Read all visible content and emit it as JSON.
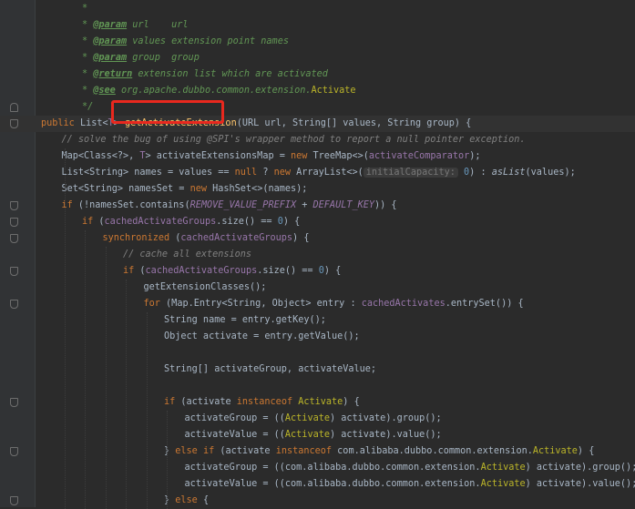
{
  "editor": {
    "language": "Java",
    "highlight": {
      "label": "getActivateExtension",
      "color": "#e8281e"
    },
    "lines": [
      {
        "indent": 4,
        "fold": "",
        "tokens": [
          {
            "t": "*",
            "c": "c-doc"
          }
        ]
      },
      {
        "indent": 4,
        "fold": "",
        "tokens": [
          {
            "t": "* ",
            "c": "c-doc"
          },
          {
            "t": "@param",
            "c": "c-tag"
          },
          {
            "t": " url    url",
            "c": "c-doc"
          }
        ]
      },
      {
        "indent": 4,
        "fold": "",
        "tokens": [
          {
            "t": "* ",
            "c": "c-doc"
          },
          {
            "t": "@param",
            "c": "c-tag"
          },
          {
            "t": " values extension point names",
            "c": "c-doc"
          }
        ]
      },
      {
        "indent": 4,
        "fold": "",
        "tokens": [
          {
            "t": "* ",
            "c": "c-doc"
          },
          {
            "t": "@param",
            "c": "c-tag"
          },
          {
            "t": " group  group",
            "c": "c-doc"
          }
        ]
      },
      {
        "indent": 4,
        "fold": "",
        "tokens": [
          {
            "t": "* ",
            "c": "c-doc"
          },
          {
            "t": "@return",
            "c": "c-tag"
          },
          {
            "t": " extension list which are activated",
            "c": "c-doc"
          }
        ]
      },
      {
        "indent": 4,
        "fold": "",
        "tokens": [
          {
            "t": "* ",
            "c": "c-doc"
          },
          {
            "t": "@see",
            "c": "c-tag"
          },
          {
            "t": " org.apache.dubbo.common.extension.",
            "c": "c-doc"
          },
          {
            "t": "Activate",
            "c": "c-ann"
          }
        ]
      },
      {
        "indent": 4,
        "fold": "close",
        "tokens": [
          {
            "t": "*/",
            "c": "c-doc"
          }
        ]
      },
      {
        "indent": 0,
        "fold": "open",
        "caret": true,
        "tokens": [
          {
            "t": "public ",
            "c": "c-kw"
          },
          {
            "t": "List<",
            "c": "c-type"
          },
          {
            "t": "T",
            "c": "c-fld"
          },
          {
            "t": "> ",
            "c": "c-type"
          },
          {
            "t": "getActivateExtension",
            "c": "c-fn"
          },
          {
            "t": "(URL url, String[] values, String group) {",
            "c": "c-type"
          }
        ]
      },
      {
        "indent": 2,
        "fold": "",
        "tokens": [
          {
            "t": "// solve the bug of using @SPI's wrapper method to report a null pointer exception.",
            "c": "c-cmt"
          }
        ]
      },
      {
        "indent": 2,
        "fold": "",
        "tokens": [
          {
            "t": "Map<Class<?>, ",
            "c": "c-type"
          },
          {
            "t": "T",
            "c": "c-fld"
          },
          {
            "t": "> activateExtensionsMap = ",
            "c": "c-type"
          },
          {
            "t": "new ",
            "c": "c-kw"
          },
          {
            "t": "TreeMap<>(",
            "c": "c-type"
          },
          {
            "t": "activateComparator",
            "c": "c-fld"
          },
          {
            "t": ");",
            "c": "c-type"
          }
        ]
      },
      {
        "indent": 2,
        "fold": "",
        "tokens": [
          {
            "t": "List<String> names = values == ",
            "c": "c-type"
          },
          {
            "t": "null",
            "c": "c-kw"
          },
          {
            "t": " ? ",
            "c": "c-type"
          },
          {
            "t": "new ",
            "c": "c-kw"
          },
          {
            "t": "ArrayList<>(",
            "c": "c-type"
          },
          {
            "t": "initialCapacity:",
            "c": "c-hint"
          },
          {
            "t": " ",
            "c": "c-type"
          },
          {
            "t": "0",
            "c": "c-num"
          },
          {
            "t": ") : ",
            "c": "c-type"
          },
          {
            "t": "asList",
            "c": "c-smeth"
          },
          {
            "t": "(values);",
            "c": "c-type"
          }
        ]
      },
      {
        "indent": 2,
        "fold": "",
        "tokens": [
          {
            "t": "Set<String> namesSet = ",
            "c": "c-type"
          },
          {
            "t": "new ",
            "c": "c-kw"
          },
          {
            "t": "HashSet<>(names);",
            "c": "c-type"
          }
        ]
      },
      {
        "indent": 2,
        "fold": "open",
        "tokens": [
          {
            "t": "if ",
            "c": "c-kw"
          },
          {
            "t": "(!namesSet.contains(",
            "c": "c-type"
          },
          {
            "t": "REMOVE_VALUE_PREFIX",
            "c": "c-sfld"
          },
          {
            "t": " + ",
            "c": "c-type"
          },
          {
            "t": "DEFAULT_KEY",
            "c": "c-sfld"
          },
          {
            "t": ")) {",
            "c": "c-type"
          }
        ]
      },
      {
        "indent": 4,
        "fold": "open",
        "tokens": [
          {
            "t": "if ",
            "c": "c-kw"
          },
          {
            "t": "(",
            "c": "c-type"
          },
          {
            "t": "cachedActivateGroups",
            "c": "c-fld"
          },
          {
            "t": ".size() == ",
            "c": "c-type"
          },
          {
            "t": "0",
            "c": "c-num"
          },
          {
            "t": ") {",
            "c": "c-type"
          }
        ]
      },
      {
        "indent": 6,
        "fold": "open",
        "tokens": [
          {
            "t": "synchronized ",
            "c": "c-kw"
          },
          {
            "t": "(",
            "c": "c-type"
          },
          {
            "t": "cachedActivateGroups",
            "c": "c-fld"
          },
          {
            "t": ") {",
            "c": "c-type"
          }
        ]
      },
      {
        "indent": 8,
        "fold": "",
        "tokens": [
          {
            "t": "// cache all extensions",
            "c": "c-cmt"
          }
        ]
      },
      {
        "indent": 8,
        "fold": "open",
        "tokens": [
          {
            "t": "if ",
            "c": "c-kw"
          },
          {
            "t": "(",
            "c": "c-type"
          },
          {
            "t": "cachedActivateGroups",
            "c": "c-fld"
          },
          {
            "t": ".size() == ",
            "c": "c-type"
          },
          {
            "t": "0",
            "c": "c-num"
          },
          {
            "t": ") {",
            "c": "c-type"
          }
        ]
      },
      {
        "indent": 10,
        "fold": "",
        "tokens": [
          {
            "t": "getExtensionClasses();",
            "c": "c-type"
          }
        ]
      },
      {
        "indent": 10,
        "fold": "open",
        "tokens": [
          {
            "t": "for ",
            "c": "c-kw"
          },
          {
            "t": "(Map.Entry<String, Object> entry : ",
            "c": "c-type"
          },
          {
            "t": "cachedActivates",
            "c": "c-fld"
          },
          {
            "t": ".entrySet()) {",
            "c": "c-type"
          }
        ]
      },
      {
        "indent": 12,
        "fold": "",
        "tokens": [
          {
            "t": "String name = entry.getKey();",
            "c": "c-type"
          }
        ]
      },
      {
        "indent": 12,
        "fold": "",
        "tokens": [
          {
            "t": "Object activate = entry.getValue();",
            "c": "c-type"
          }
        ]
      },
      {
        "indent": 12,
        "fold": "",
        "tokens": []
      },
      {
        "indent": 12,
        "fold": "",
        "tokens": [
          {
            "t": "String[] activateGroup, activateValue;",
            "c": "c-type"
          }
        ]
      },
      {
        "indent": 12,
        "fold": "",
        "tokens": []
      },
      {
        "indent": 12,
        "fold": "open",
        "tokens": [
          {
            "t": "if ",
            "c": "c-kw"
          },
          {
            "t": "(activate ",
            "c": "c-type"
          },
          {
            "t": "instanceof ",
            "c": "c-kw"
          },
          {
            "t": "Activate",
            "c": "c-ann"
          },
          {
            "t": ") {",
            "c": "c-type"
          }
        ]
      },
      {
        "indent": 14,
        "fold": "",
        "tokens": [
          {
            "t": "activateGroup = ((",
            "c": "c-type"
          },
          {
            "t": "Activate",
            "c": "c-ann"
          },
          {
            "t": ") activate).group();",
            "c": "c-type"
          }
        ]
      },
      {
        "indent": 14,
        "fold": "",
        "tokens": [
          {
            "t": "activateValue = ((",
            "c": "c-type"
          },
          {
            "t": "Activate",
            "c": "c-ann"
          },
          {
            "t": ") activate).value();",
            "c": "c-type"
          }
        ]
      },
      {
        "indent": 12,
        "fold": "both",
        "tokens": [
          {
            "t": "} ",
            "c": "c-type"
          },
          {
            "t": "else if ",
            "c": "c-kw"
          },
          {
            "t": "(activate ",
            "c": "c-type"
          },
          {
            "t": "instanceof ",
            "c": "c-kw"
          },
          {
            "t": "com.alibaba.dubbo.common.extension.",
            "c": "c-type"
          },
          {
            "t": "Activate",
            "c": "c-ann"
          },
          {
            "t": ") {",
            "c": "c-type"
          }
        ]
      },
      {
        "indent": 14,
        "fold": "",
        "tokens": [
          {
            "t": "activateGroup = ((com.alibaba.dubbo.common.extension.",
            "c": "c-type"
          },
          {
            "t": "Activate",
            "c": "c-ann"
          },
          {
            "t": ") activate).group();",
            "c": "c-type"
          }
        ]
      },
      {
        "indent": 14,
        "fold": "",
        "tokens": [
          {
            "t": "activateValue = ((com.alibaba.dubbo.common.extension.",
            "c": "c-type"
          },
          {
            "t": "Activate",
            "c": "c-ann"
          },
          {
            "t": ") activate).value();",
            "c": "c-type"
          }
        ]
      },
      {
        "indent": 12,
        "fold": "both",
        "tokens": [
          {
            "t": "} ",
            "c": "c-type"
          },
          {
            "t": "else ",
            "c": "c-kw"
          },
          {
            "t": "{",
            "c": "c-type"
          }
        ]
      }
    ]
  }
}
